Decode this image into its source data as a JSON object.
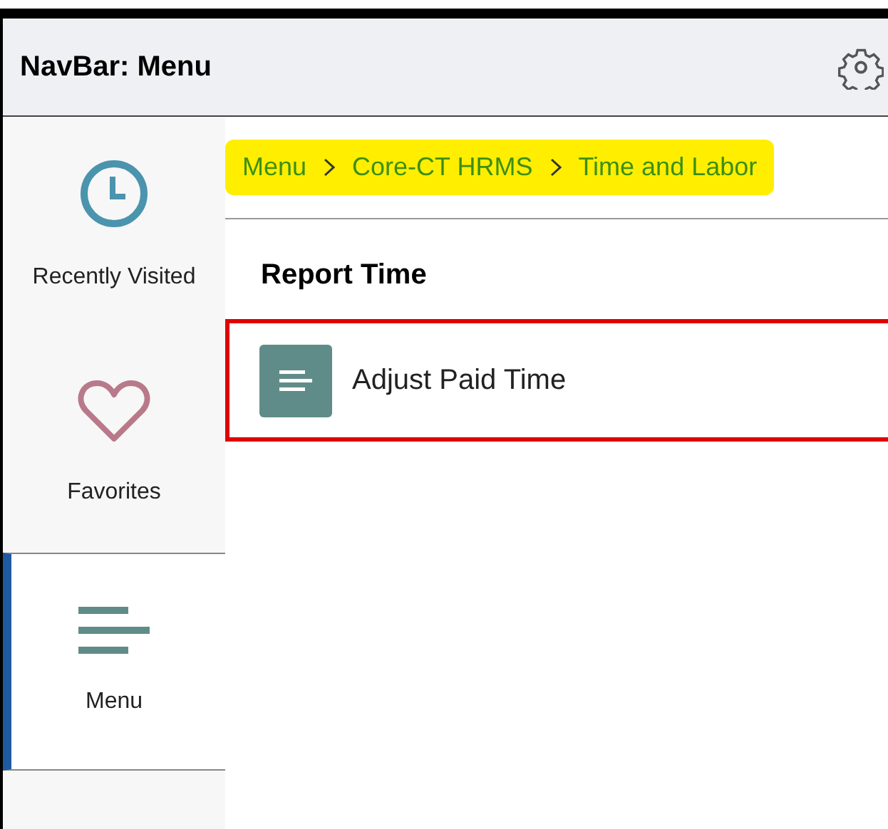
{
  "header": {
    "title": "NavBar: Menu"
  },
  "sidebar": {
    "items": [
      {
        "kind": "clock",
        "label": "Recently Visited",
        "selected": false
      },
      {
        "kind": "heart",
        "label": "Favorites",
        "selected": false
      },
      {
        "kind": "menu",
        "label": "Menu",
        "selected": true
      }
    ]
  },
  "breadcrumb": {
    "highlighted": true,
    "items": [
      "Menu",
      "Core-CT HRMS",
      "Time and Labor"
    ]
  },
  "section": {
    "title": "Report Time",
    "tiles": [
      {
        "label": "Adjust Paid Time",
        "outlined": true
      }
    ]
  }
}
